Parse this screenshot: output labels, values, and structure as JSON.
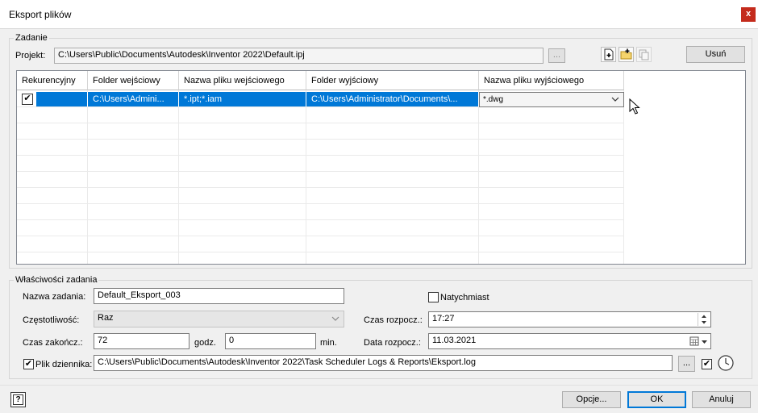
{
  "window": {
    "title": "Eksport plików",
    "close": "x"
  },
  "task": {
    "group_label": "Zadanie",
    "project_label": "Projekt:",
    "project_path": "C:\\Users\\Public\\Documents\\Autodesk\\Inventor 2022\\Default.ipj",
    "browse_label": "...",
    "remove_label": "Usuń"
  },
  "grid": {
    "headers": [
      "Rekurencyjny",
      "Folder wejściowy",
      "Nazwa pliku wejściowego",
      "Folder wyjściowy",
      "Nazwa pliku wyjściowego"
    ],
    "row": {
      "recursive": "✔",
      "input_folder": "C:\\Users\\Admini...",
      "input_name": "*.ipt;*.iam",
      "output_folder": "C:\\Users\\Administrator\\Documents\\...",
      "output_name": "*.dwg"
    }
  },
  "props": {
    "group_label": "Właściwości zadania",
    "name_label": "Nazwa zadania:",
    "name_value": "Default_Eksport_003",
    "immediate_label": "Natychmiast",
    "freq_label": "Częstotliwość:",
    "freq_value": "Raz",
    "start_time_label": "Czas rozpocz.:",
    "start_time_value": "17:27",
    "end_label": "Czas zakończ.:",
    "end_hours": "72",
    "hours_unit": "godz.",
    "end_minutes": "0",
    "minutes_unit": "min.",
    "start_date_label": "Data rozpocz.:",
    "start_date_value": "11.03.2021",
    "log_label": "Plik dziennika:",
    "log_checked": "✔",
    "log_path": "C:\\Users\\Public\\Documents\\Autodesk\\Inventor 2022\\Task Scheduler Logs & Reports\\Eksport.log",
    "log_browse": "...",
    "log_option_checked": "✔"
  },
  "footer": {
    "help": "?",
    "options": "Opcje...",
    "ok": "OK",
    "cancel": "Anuluj"
  }
}
